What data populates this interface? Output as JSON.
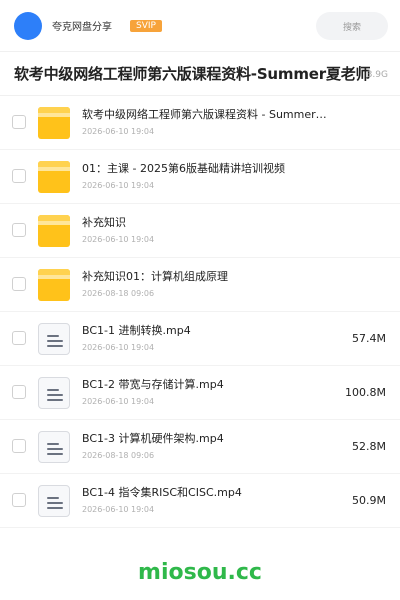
{
  "header": {
    "user_name": "夸克网盘分享",
    "badge": "SVIP",
    "search_label": "搜索"
  },
  "folder": {
    "title": "软考中级网络工程师第六版课程资料-Summer夏老师",
    "total_size": "3.9G"
  },
  "files": [
    {
      "type": "folder",
      "icon": "folder-icon",
      "name": "软考中级网络工程师第六版课程资料 - Summer…",
      "date": "2026-06-10 19:04",
      "size": ""
    },
    {
      "type": "folder",
      "icon": "folder-icon",
      "name": "01：主课 - 2025第6版基础精讲培训视频",
      "date": "2026-06-10 19:04",
      "size": ""
    },
    {
      "type": "folder",
      "icon": "folder-icon",
      "name": "补充知识",
      "date": "2026-06-10 19:04",
      "size": ""
    },
    {
      "type": "folder",
      "icon": "folder-icon",
      "name": "补充知识01：计算机组成原理",
      "date": "2026-08-18 09:06",
      "size": ""
    },
    {
      "type": "video",
      "icon": "file-doc-icon",
      "name": "BC1-1 进制转换.mp4",
      "date": "2026-06-10 19:04",
      "size": "57.4M"
    },
    {
      "type": "video",
      "icon": "file-doc-icon",
      "name": "BC1-2 带宽与存储计算.mp4",
      "date": "2026-06-10 19:04",
      "size": "100.8M"
    },
    {
      "type": "video",
      "icon": "file-doc-icon",
      "name": "BC1-3 计算机硬件架构.mp4",
      "date": "2026-08-18 09:06",
      "size": "52.8M"
    },
    {
      "type": "video",
      "icon": "file-doc-icon",
      "name": "BC1-4 指令集RISC和CISC.mp4",
      "date": "2026-06-10 19:04",
      "size": "50.9M"
    }
  ],
  "watermark": "miosou.cc",
  "colors": {
    "accent": "#2d7ff9",
    "svip": "#f7a33a",
    "folder": "#ffc21a",
    "watermark": "#2fb84a"
  }
}
